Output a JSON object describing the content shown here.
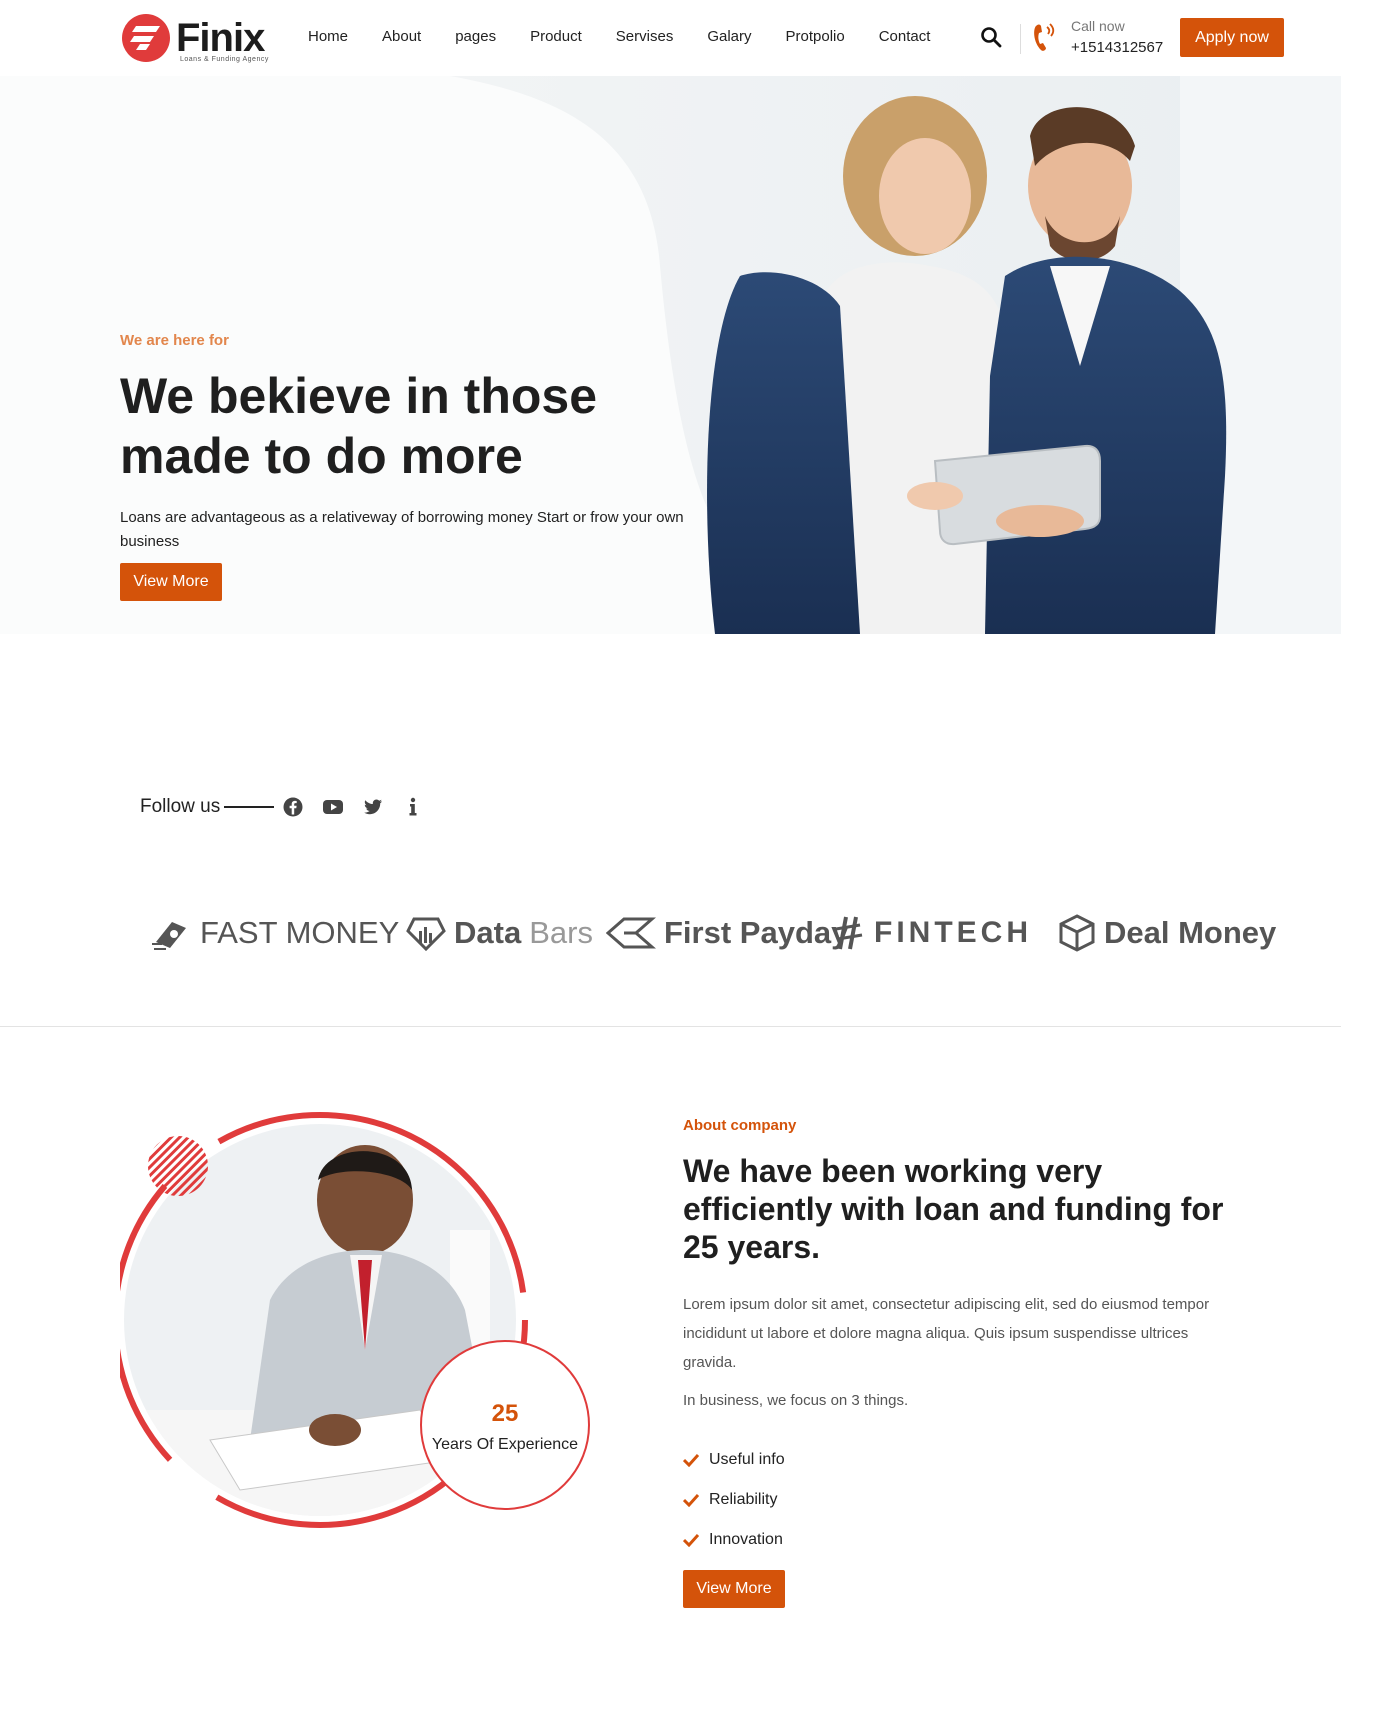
{
  "brand": {
    "name": "Finix",
    "tagline": "Loans & Funding Agency",
    "accent": "#d4530a",
    "logo_red": "#e03b3b"
  },
  "nav": {
    "items": [
      "Home",
      "About",
      "pages",
      "Product",
      "Servises",
      "Galary",
      "Protpolio",
      "Contact"
    ]
  },
  "header": {
    "call_label": "Call now",
    "call_number": "+1514312567",
    "apply_label": "Apply now"
  },
  "hero": {
    "eyebrow": "We are here for",
    "title": "We bekieve in those made to do more",
    "description": "Loans are advantageous as a relativeway of borrowing money Start or frow your own business",
    "button": "View More"
  },
  "follow": {
    "label": "Follow us",
    "icons": [
      "facebook-icon",
      "youtube-icon",
      "twitter-icon",
      "info-icon"
    ]
  },
  "partners": [
    {
      "name": "FAST MONEY",
      "icon": "fast-money-icon"
    },
    {
      "name_bold": "Data",
      "name_light": "Bars",
      "icon": "data-bars-icon"
    },
    {
      "name": "First Payday",
      "icon": "first-payday-icon"
    },
    {
      "name": "FINTECH",
      "icon": "fintech-icon"
    },
    {
      "name": "Deal Money",
      "icon": "deal-money-icon"
    }
  ],
  "about": {
    "eyebrow": "About company",
    "title": "We have been working very efficiently with loan and funding for 25 years.",
    "description": "Lorem ipsum dolor sit amet, consectetur adipiscing elit, sed do eiusmod tempor incididunt ut labore et dolore magna aliqua. Quis ipsum suspendisse ultrices gravida.",
    "focus_intro": "In business, we focus on 3 things.",
    "points": [
      "Useful info",
      "Reliability",
      "Innovation"
    ],
    "button": "View More",
    "experience_number": "25",
    "experience_label": "Years Of Experience"
  }
}
